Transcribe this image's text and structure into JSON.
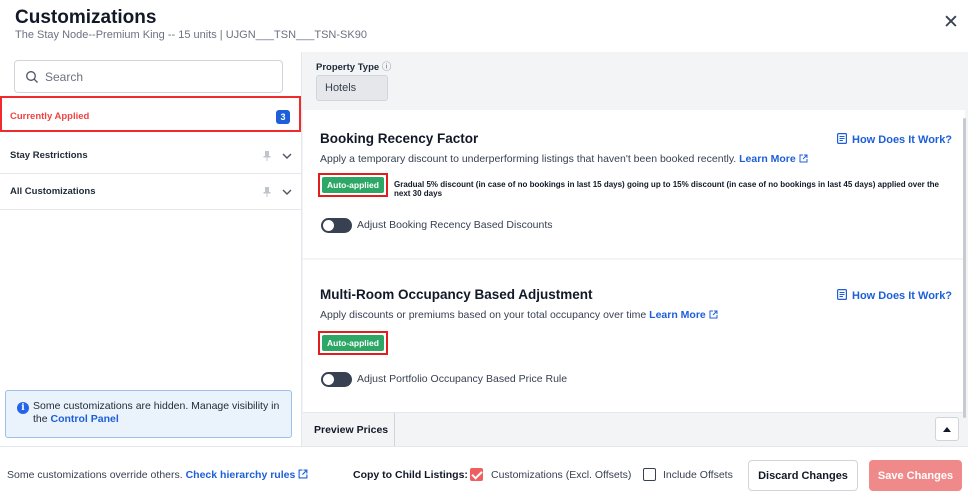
{
  "header": {
    "title": "Customizations",
    "subtitle": "The Stay Node--Premium King -- 15 units | UJGN___TSN___TSN-SK90",
    "close_icon": "close-icon"
  },
  "sidebar": {
    "search": {
      "placeholder": "Search",
      "value": ""
    },
    "items": [
      {
        "label": "Currently Applied",
        "badge": "3",
        "active": true
      },
      {
        "label": "Stay Restrictions",
        "icons": [
          "pin-icon",
          "chevron-down-icon"
        ]
      },
      {
        "label": "All Customizations",
        "icons": [
          "pin-icon",
          "chevron-down-icon"
        ]
      }
    ],
    "notice": {
      "text": "Some customizations are hidden. Manage visibility in the ",
      "link": "Control Panel"
    }
  },
  "main": {
    "property_type": {
      "label": "Property Type",
      "value": "Hotels"
    },
    "cards": [
      {
        "title": "Booking Recency Factor",
        "how": "How Does It Work?",
        "description": "Apply a temporary discount to underperforming listings that haven't been booked recently.",
        "learn_more": "Learn More",
        "status": "Auto-applied",
        "status_detail": "Gradual 5% discount (in case of no bookings in last 15 days) going up to 15% discount (in case of no bookings in last 45 days) applied over the next 30 days",
        "toggle_label": "Adjust Booking Recency Based Discounts",
        "toggle_on": false
      },
      {
        "title": "Multi-Room Occupancy Based Adjustment",
        "how": "How Does It Work?",
        "description": "Apply discounts or premiums based on your total occupancy over time",
        "learn_more": "Learn More",
        "status": "Auto-applied",
        "toggle_label": "Adjust Portfolio Occupancy Based Price Rule",
        "toggle_on": false
      }
    ],
    "preview_tab": "Preview Prices"
  },
  "footer": {
    "override_text": "Some customizations override others.",
    "hierarchy_link": "Check hierarchy rules",
    "copy_label": "Copy to Child Listings:",
    "options": [
      {
        "label": "Customizations (Excl. Offsets)",
        "checked": true
      },
      {
        "label": "Include Offsets",
        "checked": false
      }
    ],
    "discard": "Discard Changes",
    "save": "Save Changes"
  },
  "colors": {
    "primary_link": "#1d5fd8",
    "auto_applied": "#2ca765",
    "save_button": "#f08a8a",
    "highlight_border": "#e21d1d"
  }
}
